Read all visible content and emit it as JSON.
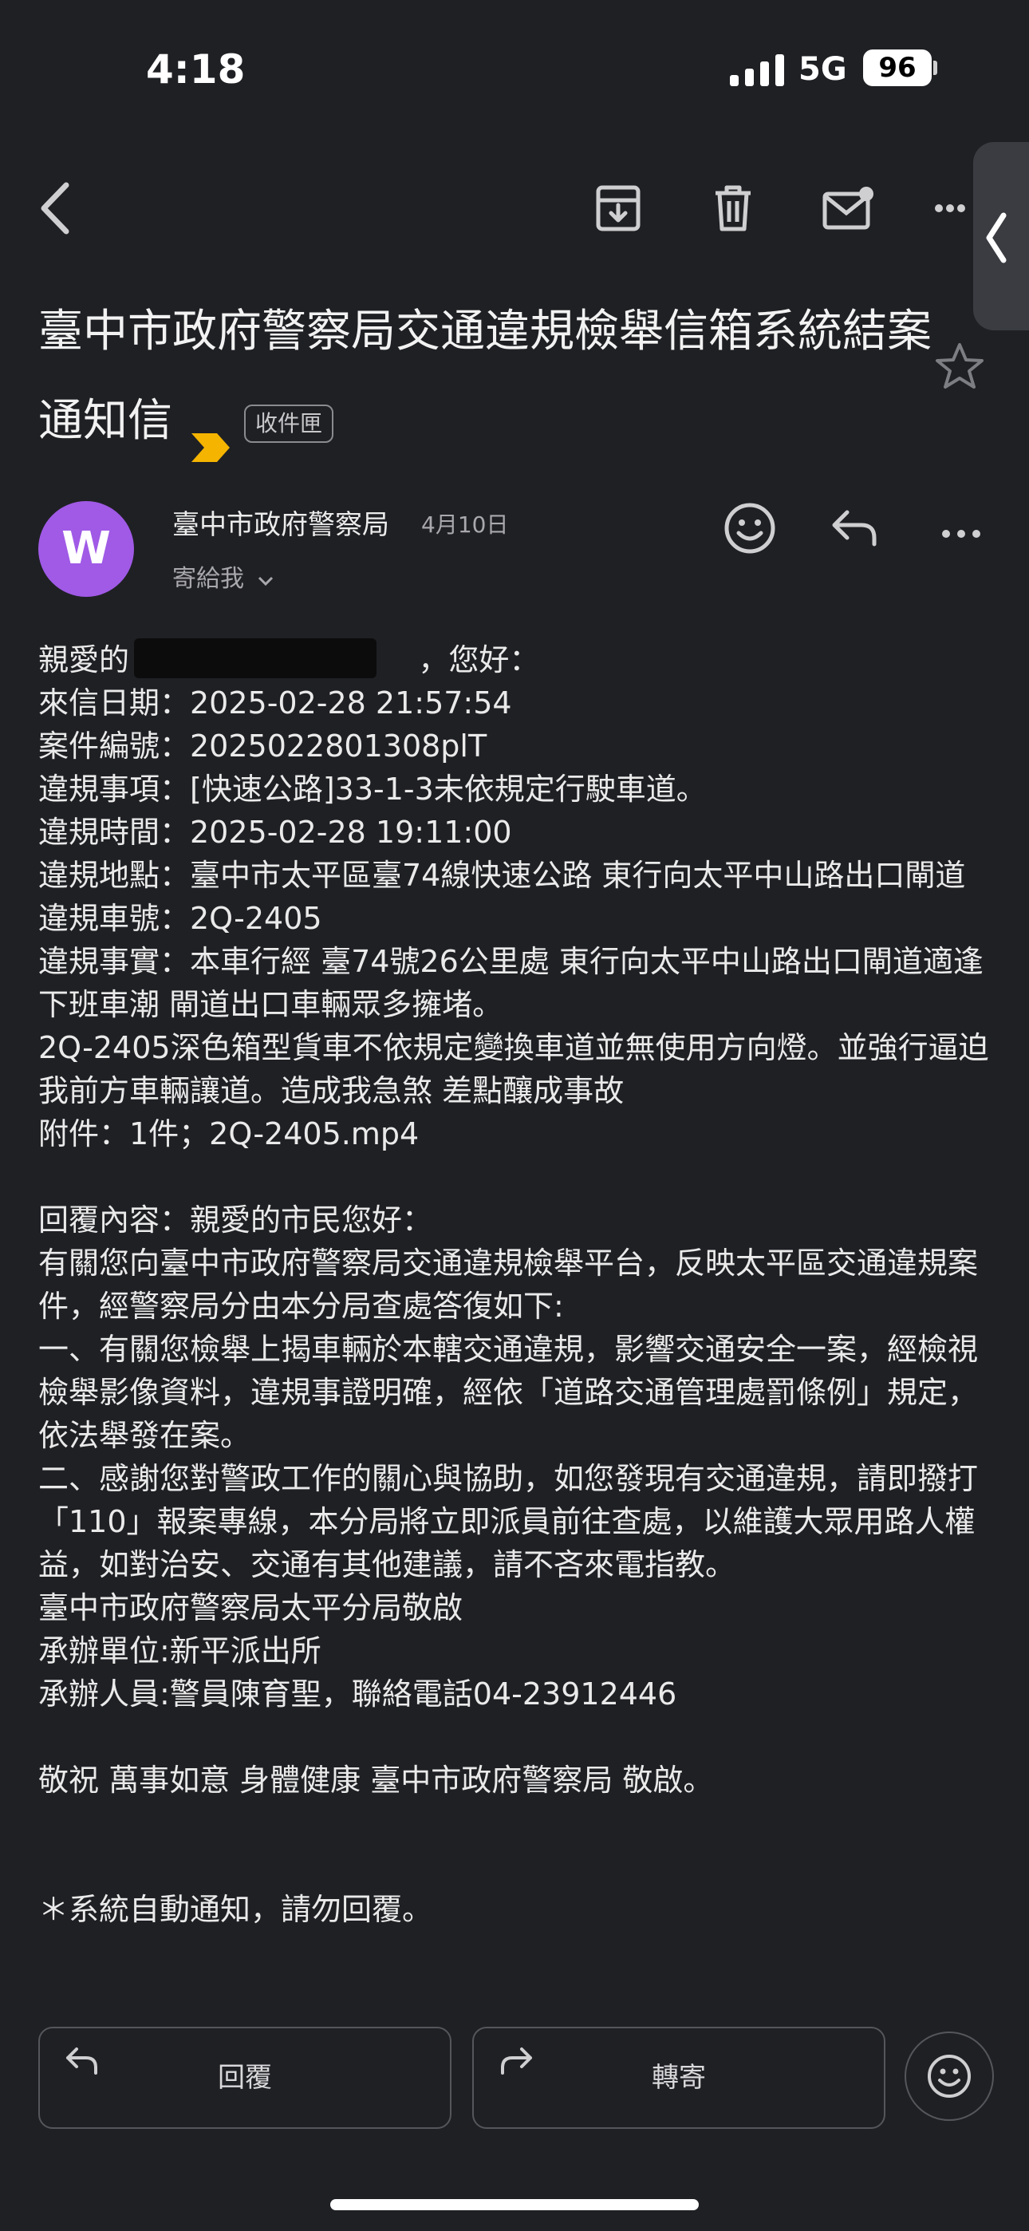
{
  "status_bar": {
    "time": "4:18",
    "network": "5G",
    "battery": "96"
  },
  "toolbar": {
    "icons": [
      "back-chevron-icon",
      "archive-icon",
      "trash-icon",
      "mark-unread-icon",
      "more-horizontal-icon"
    ]
  },
  "email": {
    "subject": "臺中市政府警察局交通違規檢舉信箱系統結案通知信",
    "label": "收件匣",
    "sender_initial": "W",
    "sender": "臺中市政府警察局",
    "date": "4月10日",
    "to": "寄給我",
    "body_lines": [
      "親愛的                              ，您好：",
      "來信日期：2025-02-28 21:57:54",
      "案件編號：2025022801308plT",
      "違規事項：[快速公路]33-1-3未依規定行駛車道。",
      "違規時間：2025-02-28 19:11:00",
      "違規地點：臺中市太平區臺74線快速公路 東行向太平中山路出口閘道",
      "違規車號：2Q-2405",
      "違規事實：本車行經 臺74號26公里處 東行向太平中山路出口閘道適逢下班車潮 閘道出口車輛眾多擁堵。",
      "2Q-2405深色箱型貨車不依規定變換車道並無使用方向燈。並強行逼迫我前方車輛讓道。造成我急煞 差點釀成事故",
      "附件：1件；2Q-2405.mp4",
      "",
      "回覆內容：親愛的市民您好：",
      "有關您向臺中市政府警察局交通違規檢舉平台，反映太平區交通違規案件，經警察局分由本分局查處答復如下:",
      "一、有關您檢舉上揭車輛於本轄交通違規，影響交通安全一案，經檢視檢舉影像資料，違規事證明確，經依「道路交通管理處罰條例」規定，依法舉發在案。",
      "二、感謝您對警政工作的關心與協助，如您發現有交通違規，請即撥打「110」報案專線，本分局將立即派員前往查處，以維護大眾用路人權益，如對治安、交通有其他建議，請不吝來電指教。",
      "臺中市政府警察局太平分局敬啟",
      "承辦單位:新平派出所",
      "承辦人員:警員陳育聖，聯絡電話04-23912446",
      "",
      "敬祝 萬事如意 身體健康 臺中市政府警察局 敬啟。",
      "",
      "",
      "＊系統自動通知，請勿回覆。"
    ]
  },
  "actions": {
    "reply": "回覆",
    "forward": "轉寄"
  }
}
